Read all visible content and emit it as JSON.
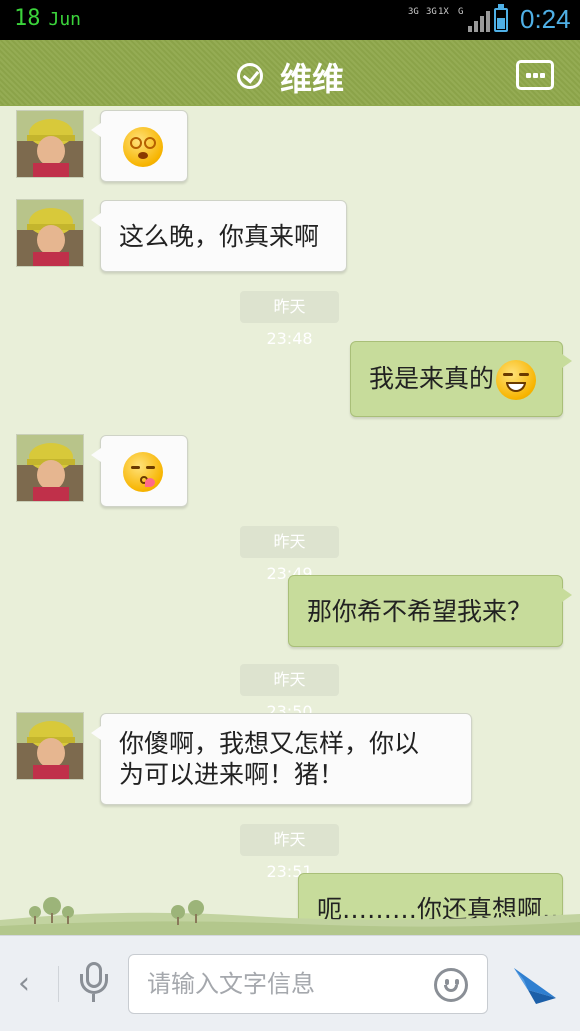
{
  "status_bar": {
    "day": "18",
    "month": "Jun",
    "network_labels": [
      "3G",
      "3G",
      "1X",
      "G"
    ],
    "time": "0:24",
    "colors": {
      "date": "#3bd33b",
      "time": "#4fb0e6"
    }
  },
  "header": {
    "title": "维维",
    "verified_icon": "check-circle-icon",
    "more_icon": "more-dots-icon",
    "color": "#8fa84b"
  },
  "messages": [
    {
      "side": "in",
      "emoji": "dizzy-emoji"
    },
    {
      "side": "in",
      "text": "这么晚，你真来啊"
    },
    {
      "type": "time",
      "text": "昨天 23:48"
    },
    {
      "side": "out",
      "text": "我是来真的",
      "emoji": "smirk-emoji"
    },
    {
      "side": "in",
      "emoji": "kiss-emoji"
    },
    {
      "type": "time",
      "text": "昨天 23:49"
    },
    {
      "side": "out",
      "text": "那你希不希望我来？"
    },
    {
      "type": "time",
      "text": "昨天 23:50"
    },
    {
      "side": "in",
      "line1": "你傻啊，我想又怎样，你以",
      "line2": "为可以进来啊！猪！"
    },
    {
      "type": "time",
      "text": "昨天 23:51"
    },
    {
      "side": "out",
      "text": "呃………你还真想啊…"
    }
  ],
  "input_bar": {
    "placeholder": "请输入文字信息",
    "back_icon": "chevron-left-icon",
    "mic_icon": "microphone-icon",
    "emoji_icon": "smiley-icon",
    "send_icon": "send-icon",
    "send_color": "#2f7fd0"
  }
}
